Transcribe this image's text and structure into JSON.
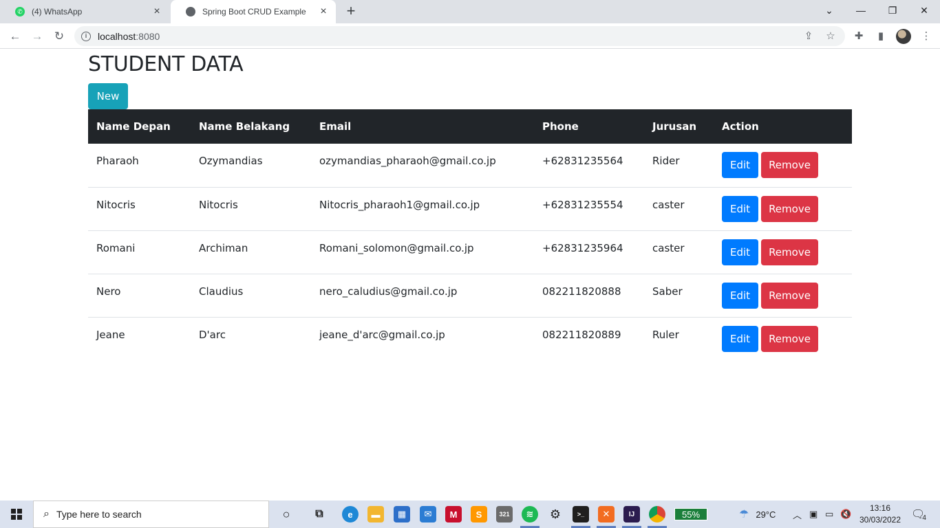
{
  "browser": {
    "tabs": [
      {
        "title": "(4) WhatsApp",
        "active": false,
        "favicon": "whatsapp-icon"
      },
      {
        "title": "Spring Boot CRUD Example",
        "active": true,
        "favicon": "globe-icon"
      }
    ],
    "new_tab_symbol": "+",
    "address": {
      "host": "localhost",
      "port": ":8080"
    },
    "icons": [
      "back-icon",
      "forward-icon",
      "reload-icon",
      "site-info-icon",
      "share-icon",
      "bookmark-star-icon",
      "extensions-icon",
      "side-panel-icon",
      "profile-avatar",
      "menu-icon"
    ]
  },
  "page": {
    "title": "STUDENT DATA",
    "new_button": "New",
    "table": {
      "headers": [
        "Name Depan",
        "Name Belakang",
        "Email",
        "Phone",
        "Jurusan",
        "Action"
      ],
      "rows": [
        {
          "first": "Pharaoh",
          "last": "Ozymandias",
          "email": "ozymandias_pharaoh@gmail.co.jp",
          "phone": "+62831235564",
          "jurusan": "Rider"
        },
        {
          "first": "Nitocris",
          "last": "Nitocris",
          "email": "Nitocris_pharaoh1@gmail.co.jp",
          "phone": "+62831235554",
          "jurusan": "caster"
        },
        {
          "first": "Romani",
          "last": "Archiman",
          "email": "Romani_solomon@gmail.co.jp",
          "phone": "+62831235964",
          "jurusan": "caster"
        },
        {
          "first": "Nero",
          "last": "Claudius",
          "email": "nero_caludius@gmail.co.jp",
          "phone": "082211820888",
          "jurusan": "Saber"
        },
        {
          "first": "Jeane",
          "last": "D'arc",
          "email": "jeane_d'arc@gmail.co.jp",
          "phone": "082211820889",
          "jurusan": "Ruler"
        }
      ],
      "edit_label": "Edit",
      "remove_label": "Remove"
    },
    "colors": {
      "new": "#17a2b8",
      "edit": "#007bff",
      "remove": "#dc3545",
      "thead": "#212529"
    }
  },
  "taskbar": {
    "search_placeholder": "Type here to search",
    "battery": "55%",
    "weather": "29°C",
    "time": "13:16",
    "date": "30/03/2022",
    "notifications": "4"
  }
}
